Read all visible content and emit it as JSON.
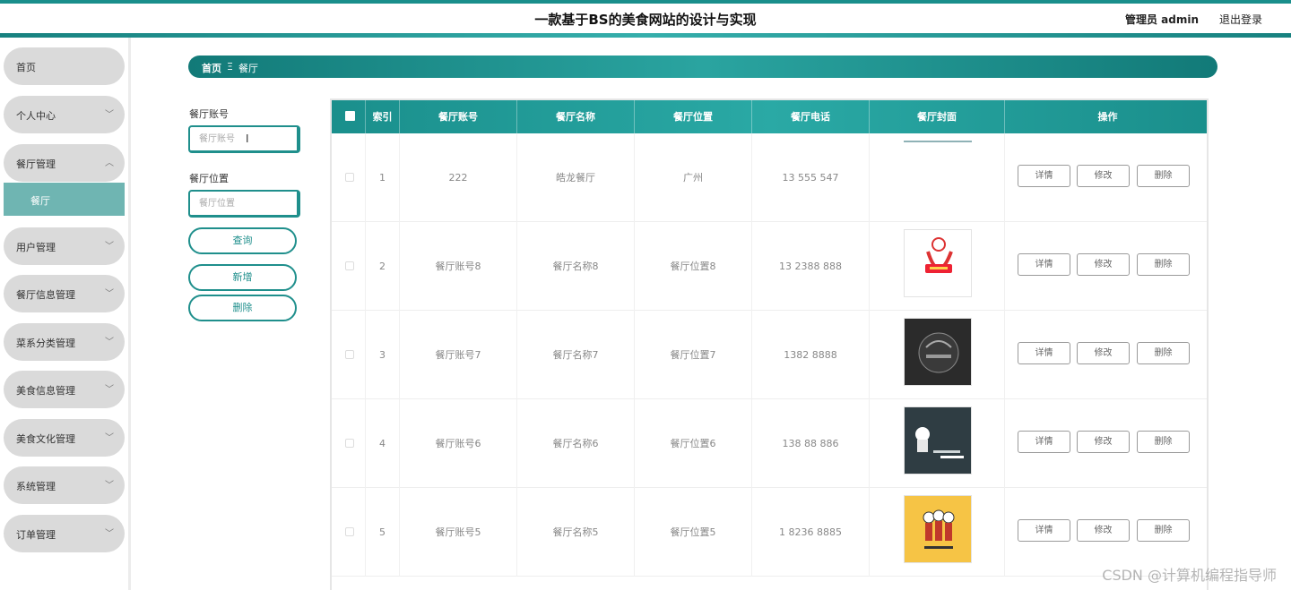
{
  "header": {
    "title": "一款基于BS的美食网站的设计与实现",
    "user": "管理员 admin",
    "logout": "退出登录"
  },
  "sidebar": {
    "items": [
      {
        "label": "首页",
        "has_arrow": false
      },
      {
        "label": "个人中心",
        "has_arrow": true
      },
      {
        "label": "餐厅管理",
        "has_arrow": true,
        "expanded": true
      },
      {
        "label": "用户管理",
        "has_arrow": true
      },
      {
        "label": "餐厅信息管理",
        "has_arrow": true
      },
      {
        "label": "菜系分类管理",
        "has_arrow": true
      },
      {
        "label": "美食信息管理",
        "has_arrow": true
      },
      {
        "label": "美食文化管理",
        "has_arrow": true
      },
      {
        "label": "系统管理",
        "has_arrow": true
      },
      {
        "label": "订单管理",
        "has_arrow": true
      }
    ],
    "sub_item": "餐厅"
  },
  "breadcrumb": {
    "home": "首页",
    "separator": "Ξ",
    "current": "餐厅"
  },
  "filters": {
    "account_label": "餐厅账号",
    "account_placeholder": "餐厅账号",
    "location_label": "餐厅位置",
    "location_placeholder": "餐厅位置",
    "search_button": "查询",
    "add_button": "新增",
    "delete_button": "删除"
  },
  "table": {
    "columns": [
      "索引",
      "餐厅账号",
      "餐厅名称",
      "餐厅位置",
      "餐厅电话",
      "餐厅封面",
      "操作"
    ],
    "rows": [
      {
        "index": "1",
        "account": "222",
        "name": "皓龙餐厅",
        "location": "广州",
        "phone": "13 555 547",
        "cover": "none"
      },
      {
        "index": "2",
        "account": "餐厅账号8",
        "name": "餐厅名称8",
        "location": "餐厅位置8",
        "phone": "13 2388 888",
        "cover": "red-chef-logo"
      },
      {
        "index": "3",
        "account": "餐厅账号7",
        "name": "餐厅名称7",
        "location": "餐厅位置7",
        "phone": "1382 8888",
        "cover": "dark-round-logo"
      },
      {
        "index": "4",
        "account": "餐厅账号6",
        "name": "餐厅名称6",
        "location": "餐厅位置6",
        "phone": "138 88 886",
        "cover": "slate-chef-logo"
      },
      {
        "index": "5",
        "account": "餐厅账号5",
        "name": "餐厅名称5",
        "location": "餐厅位置5",
        "phone": "1 8236 8885",
        "cover": "yellow-chef-logo"
      }
    ],
    "actions": {
      "detail": "详情",
      "edit": "修改",
      "delete": "删除"
    }
  },
  "watermark": "CSDN @计算机编程指导师",
  "colors": {
    "accent": "#1a8f8c",
    "sidebar_active": "#6fb5b2",
    "menu_bg": "#dadada"
  }
}
